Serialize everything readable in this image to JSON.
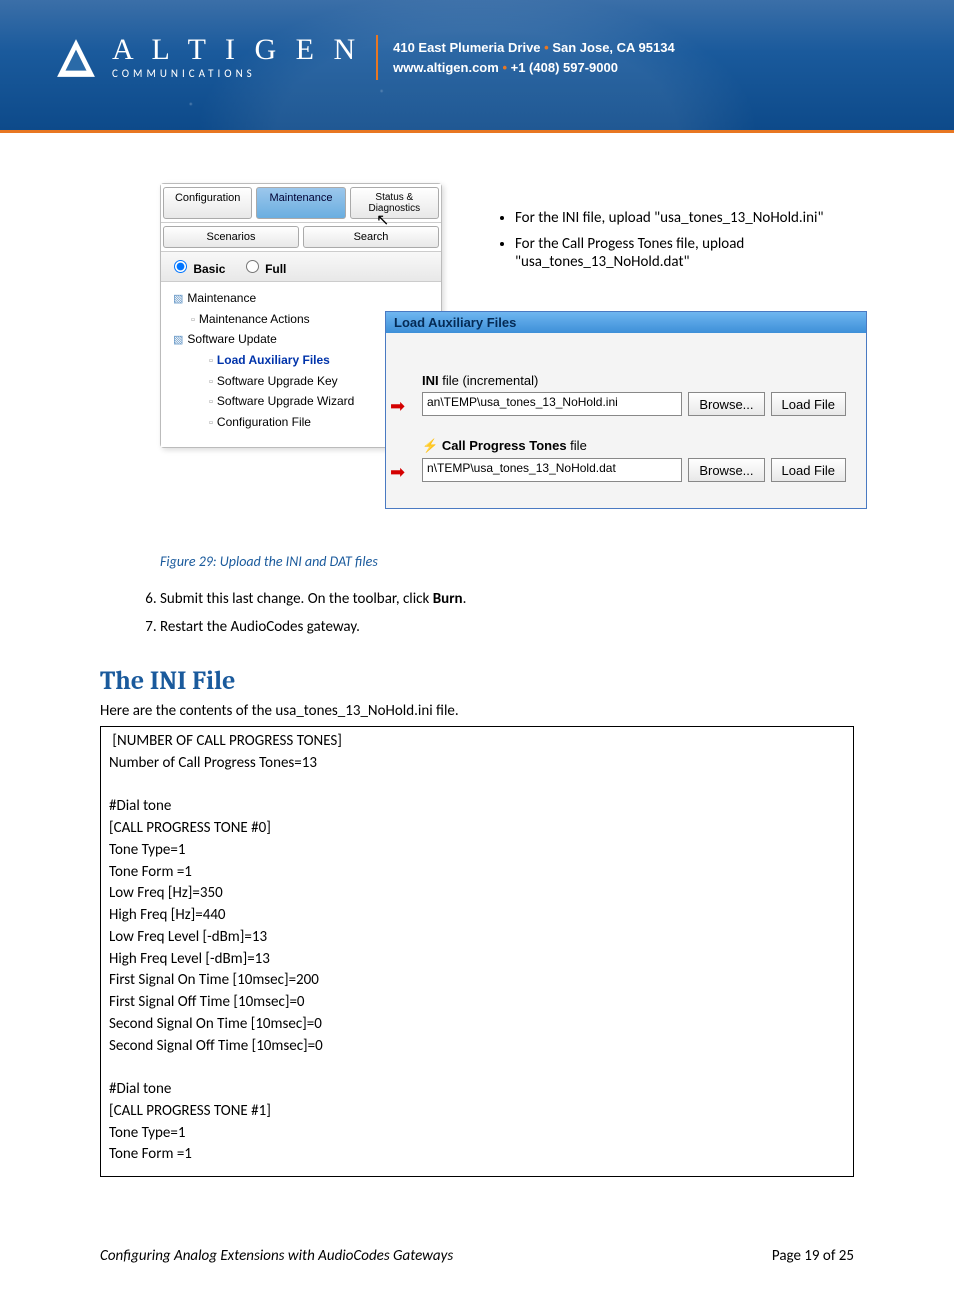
{
  "header": {
    "logo_main": "A L T I G E N",
    "logo_sub": "COMMUNICATIONS",
    "address_line1_a": "410 East Plumeria Drive",
    "address_line1_b": "San Jose, CA 95134",
    "address_line2_a": "www.altigen.com",
    "address_line2_b": "+1 (408) 597-9000"
  },
  "nav": {
    "tab_config": "Configuration",
    "tab_maint": "Maintenance",
    "tab_status": "Status & Diagnostics",
    "tab_scen": "Scenarios",
    "tab_search": "Search",
    "radio_basic": "Basic",
    "radio_full": "Full",
    "tree": {
      "maintenance": "Maintenance",
      "maint_actions": "Maintenance Actions",
      "software_update": "Software Update",
      "load_aux": "Load Auxiliary Files",
      "upgrade_key": "Software Upgrade Key",
      "upgrade_wizard": "Software Upgrade Wizard",
      "config_file": "Configuration File"
    }
  },
  "aux": {
    "title": "Load Auxiliary Files",
    "ini_label_bold": "INI",
    "ini_label_rest": " file (incremental)",
    "ini_value": "an\\TEMP\\usa_tones_13_NoHold.ini",
    "cpt_label_bold": "Call Progress Tones",
    "cpt_label_rest": " file",
    "cpt_value": "n\\TEMP\\usa_tones_13_NoHold.dat",
    "browse": "Browse...",
    "load": "Load File"
  },
  "bullets": {
    "b1": "For the INI file, upload \"usa_tones_13_NoHold.ini\"",
    "b2": "For the Call Progess Tones file, upload \"usa_tones_13_NoHold.dat\""
  },
  "caption": "Figure 29: Upload the INI and DAT files",
  "steps": {
    "s6a": "Submit this last change. On the toolbar, click ",
    "s6b": "Burn",
    "s6c": ".",
    "s7": "Restart the AudioCodes gateway."
  },
  "ini": {
    "heading": "The INI File",
    "intro": "Here are the contents of the usa_tones_13_NoHold.ini file.",
    "code": " [NUMBER OF CALL PROGRESS TONES]\nNumber of Call Progress Tones=13\n\n#Dial tone\n[CALL PROGRESS TONE #0]\nTone Type=1\nTone Form =1\nLow Freq [Hz]=350\nHigh Freq [Hz]=440\nLow Freq Level [-dBm]=13\nHigh Freq Level [-dBm]=13\nFirst Signal On Time [10msec]=200\nFirst Signal Off Time [10msec]=0\nSecond Signal On Time [10msec]=0\nSecond Signal Off Time [10msec]=0\n\n#Dial tone\n[CALL PROGRESS TONE #1]\nTone Type=1\nTone Form =1"
  },
  "footer": {
    "left": "Configuring Analog Extensions with AudioCodes Gateways",
    "right": "Page 19 of 25"
  }
}
